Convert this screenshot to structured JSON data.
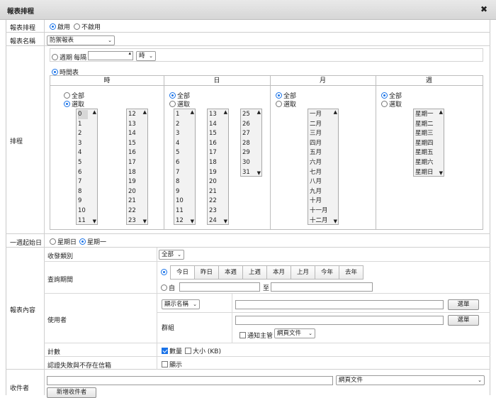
{
  "dialog": {
    "title": "報表排程",
    "close_icon": "close-icon"
  },
  "schedule_row": {
    "label": "報表排程",
    "enable": "啟用",
    "disable": "不啟用"
  },
  "report_name": {
    "label": "報表名稱",
    "value": "防禦報表"
  },
  "schedule": {
    "label": "排程",
    "cycle_label": "週期",
    "every_label": "每隔",
    "cycle_value": "",
    "cycle_unit": "時",
    "timetable_label": "時間表",
    "col_hour": "時",
    "col_day": "日",
    "col_month": "月",
    "col_week": "週",
    "all": "全部",
    "select": "選取",
    "hours_a": [
      "0",
      "1",
      "2",
      "3",
      "4",
      "5",
      "6",
      "7",
      "8",
      "9",
      "10",
      "11"
    ],
    "hours_b": [
      "12",
      "13",
      "14",
      "15",
      "16",
      "17",
      "18",
      "19",
      "20",
      "21",
      "22",
      "23"
    ],
    "days_a": [
      "1",
      "2",
      "3",
      "4",
      "5",
      "6",
      "7",
      "8",
      "9",
      "10",
      "11",
      "12"
    ],
    "days_b": [
      "13",
      "14",
      "15",
      "16",
      "17",
      "18",
      "19",
      "20",
      "21",
      "22",
      "23",
      "24"
    ],
    "days_c": [
      "25",
      "26",
      "27",
      "28",
      "29",
      "30",
      "31"
    ],
    "months": [
      "一月",
      "二月",
      "三月",
      "四月",
      "五月",
      "六月",
      "七月",
      "八月",
      "九月",
      "十月",
      "十一月",
      "十二月"
    ],
    "weekdays": [
      "星期一",
      "星期二",
      "星期三",
      "星期四",
      "星期五",
      "星期六",
      "星期日"
    ]
  },
  "week_start": {
    "label": "一週起始日",
    "sunday": "星期日",
    "monday": "星期一"
  },
  "report_content": {
    "label": "報表內容",
    "category_label": "收發類別",
    "category_value": "全部",
    "period_label": "查詢期間",
    "periods": [
      "今日",
      "昨日",
      "本週",
      "上週",
      "本月",
      "上月",
      "今年",
      "去年"
    ],
    "from_label": "自",
    "to_label": "至",
    "user_label": "使用者",
    "display_name": "顯示名稱",
    "choose": "選單",
    "group_label": "群組",
    "notify_manager": "通知主管",
    "web_doc": "網頁文件",
    "count_label": "計數",
    "count_qty": "數量",
    "count_size": "大小 (KB)",
    "auth_label": "認證失敗與不存在信箱",
    "show": "顯示"
  },
  "recipients": {
    "label": "收件者",
    "format": "網頁文件",
    "add_button": "新增收件者"
  }
}
